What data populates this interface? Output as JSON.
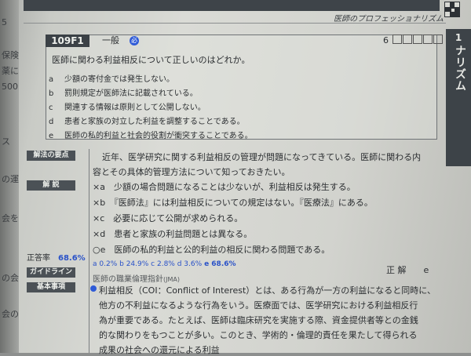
{
  "header": {
    "running_head": "医師のプロフェッショナリズム",
    "chapter_number": "1",
    "chapter_title": "医師のプロフェッショナリズム"
  },
  "left_page_fragments": [
    "5",
    "保険",
    "薬に",
    "500円",
    "ス",
    "の運営",
    "会を",
    "の会社",
    "会の合"
  ],
  "question": {
    "id": "109F1",
    "category": "一般",
    "category_mark": "必",
    "number": "6",
    "stem": "医師に関わる利益相反について正しいのはどれか。",
    "choices": [
      {
        "label": "a",
        "text": "少額の寄付金では発生しない。"
      },
      {
        "label": "b",
        "text": "罰則規定が医師法に記載されている。"
      },
      {
        "label": "c",
        "text": "関連する情報は原則として公開しない。"
      },
      {
        "label": "d",
        "text": "患者と家族の対立した利益を調整することである。"
      },
      {
        "label": "e",
        "text": "医師の私的利益と社会的役割が衝突することである。"
      }
    ]
  },
  "sidebar_tags": {
    "key_points": "解法の要点",
    "explanation": "解 説",
    "guideline": "ガイドライン",
    "basics": "基本事項"
  },
  "correct_rate": {
    "label": "正答率",
    "value": "68.6%"
  },
  "key_points_text": [
    "近年、医学研究に関する利益相反の管理が問題になってきている。医師に関わる内",
    "容とその具体的管理方法について知っておきたい。"
  ],
  "explanations": [
    {
      "mark": "×",
      "label": "a",
      "text": "少額の場合問題になることは少ないが、利益相反は発生する。"
    },
    {
      "mark": "×",
      "label": "b",
      "text": "『医師法』には利益相反についての規定はない。『医療法』にある。"
    },
    {
      "mark": "×",
      "label": "c",
      "text": "必要に応じて公開が求められる。"
    },
    {
      "mark": "×",
      "label": "d",
      "text": "患者と家族の利益問題とは異なる。"
    },
    {
      "mark": "○",
      "label": "e",
      "text": "医師の私的利益と公的利益の相反に関わる問題である。"
    }
  ],
  "distribution": {
    "a": "a 0.2%",
    "b": "b 24.9%",
    "c": "c 2.8%",
    "d": "d 3.6%",
    "e": "e 68.6%"
  },
  "guideline_text": "医師の職業倫理指針",
  "guideline_source": "(JMA)",
  "answer": {
    "label": "正 解",
    "value": "e"
  },
  "basics_lines": [
    "利益相反（COI：Conflict of Interest）とは、ある行為が一方の利益になると同時に、",
    "他方の不利益になるような行為をいう。医療面では、医学研究における利益相反行",
    "為が重要である。たとえば、医師は臨床研究を実施する際、資金提供者等との金銭",
    "的な関わりをもつことが多い。このとき、学術的・倫理的責任を果たして得られる",
    "成果の社会への還元による利益"
  ]
}
